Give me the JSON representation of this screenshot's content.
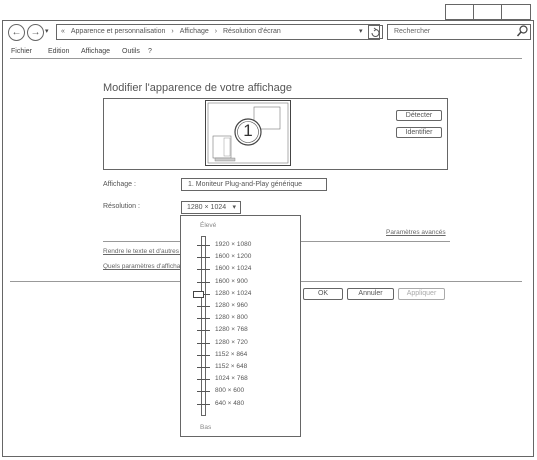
{
  "address": {
    "prefix": "«",
    "crumbs": [
      "Apparence et personnalisation",
      "Affichage",
      "Résolution d'écran"
    ],
    "separator": "›"
  },
  "search": {
    "placeholder": "Rechercher"
  },
  "menu": {
    "items": [
      "Fichier",
      "Edition",
      "Affichage",
      "Outils",
      "?"
    ]
  },
  "main": {
    "title": "Modifier l'apparence de votre affichage",
    "detect_label": "Détecter",
    "identify_label": "Identifier",
    "monitor_number": "1",
    "display_label": "Affichage :",
    "display_value": "1. Moniteur Plug-and-Play générique",
    "resolution_label": "Résolution :",
    "resolution_value": "1280 × 1024",
    "advanced_link": "Paramètres avancés",
    "info_line1": "Rendre le texte et d'autres éléments plus grands ou plus petits",
    "info_line2": "Quels paramètres d'affichage dois-je choisir ?"
  },
  "dropdown": {
    "high_label": "Élevé",
    "low_label": "Bas",
    "selected_index": 4,
    "options": [
      "1920 × 1080",
      "1600 × 1200",
      "1600 × 1024",
      "1600 × 900",
      "1280 × 1024",
      "1280 × 960",
      "1280 × 800",
      "1280 × 768",
      "1280 × 720",
      "1152 × 864",
      "1152 × 648",
      "1024 × 768",
      "800 × 600",
      "640 × 480"
    ]
  },
  "actions": {
    "ok_label": "OK",
    "cancel_label": "Annuler",
    "apply_label": "Appliquer"
  }
}
